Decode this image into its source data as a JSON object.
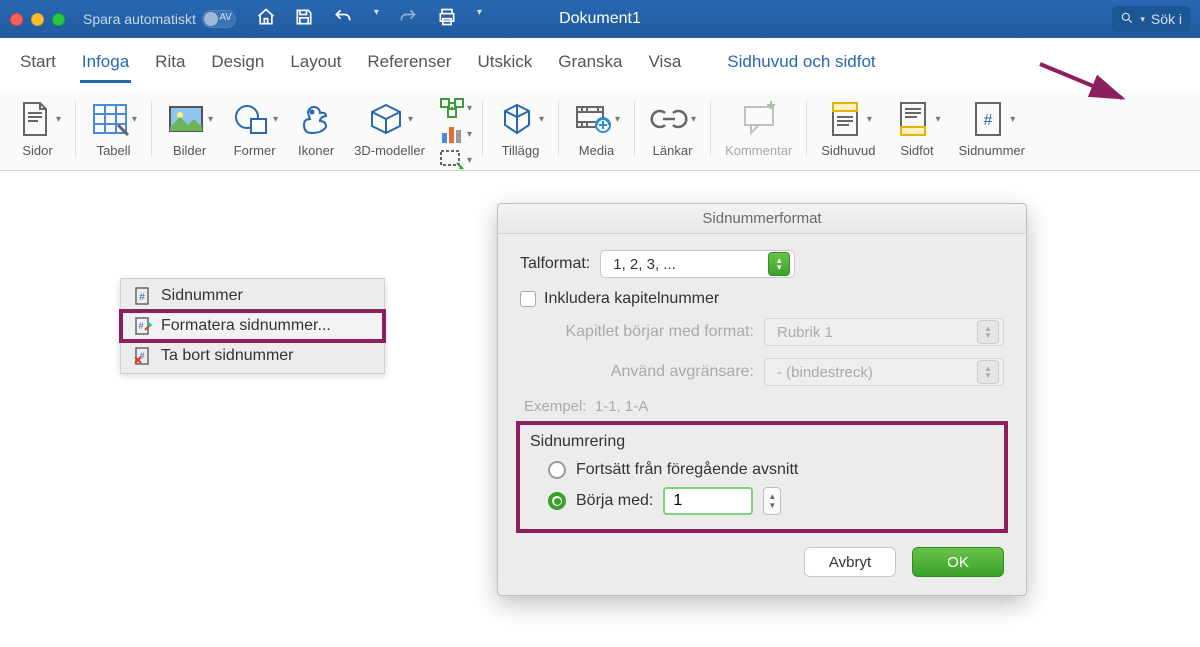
{
  "titlebar": {
    "autosave_label": "Spara automatiskt",
    "autosave_switch_text": "AV",
    "document_title": "Dokument1",
    "search_placeholder": "Sök i"
  },
  "tabs": {
    "items": [
      {
        "label": "Start"
      },
      {
        "label": "Infoga"
      },
      {
        "label": "Rita"
      },
      {
        "label": "Design"
      },
      {
        "label": "Layout"
      },
      {
        "label": "Referenser"
      },
      {
        "label": "Utskick"
      },
      {
        "label": "Granska"
      },
      {
        "label": "Visa"
      }
    ],
    "context_label": "Sidhuvud och sidfot"
  },
  "ribbon": {
    "sidor": "Sidor",
    "tabell": "Tabell",
    "bilder": "Bilder",
    "former": "Former",
    "ikoner": "Ikoner",
    "modeller": "3D-modeller",
    "tillagg": "Tillägg",
    "media": "Media",
    "lankar": "Länkar",
    "kommentar": "Kommentar",
    "sidhuvud": "Sidhuvud",
    "sidfot": "Sidfot",
    "sidnummer": "Sidnummer"
  },
  "context_menu": {
    "items": [
      {
        "label": "Sidnummer"
      },
      {
        "label": "Formatera sidnummer..."
      },
      {
        "label": "Ta bort sidnummer"
      }
    ]
  },
  "dialog": {
    "title": "Sidnummerformat",
    "number_format_label": "Talformat:",
    "number_format_value": "1, 2, 3, ...",
    "include_chapter_label": "Inkludera kapitelnummer",
    "chapter_starts_label": "Kapitlet börjar med format:",
    "chapter_starts_value": "Rubrik 1",
    "separator_label": "Använd avgränsare:",
    "separator_value": "-     (bindestreck)",
    "example_label": "Exempel:",
    "example_value": "1-1, 1-A",
    "numbering_group": "Sidnumrering",
    "continue_label": "Fortsätt från föregående avsnitt",
    "start_at_label": "Börja med:",
    "start_at_value": "1",
    "cancel": "Avbryt",
    "ok": "OK"
  }
}
